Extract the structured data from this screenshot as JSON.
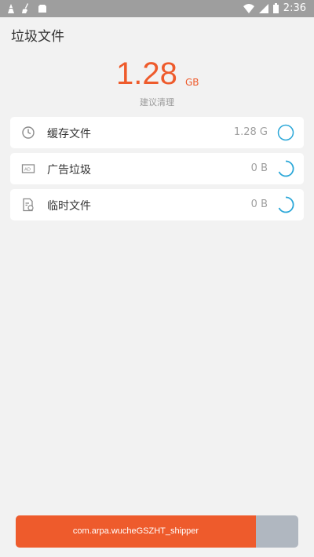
{
  "status_bar": {
    "time": "2:36"
  },
  "header": {
    "title": "垃圾文件"
  },
  "summary": {
    "size_value": "1.28",
    "size_unit": "GB",
    "hint": "建议清理"
  },
  "items": [
    {
      "label": "缓存文件",
      "value": "1.28 G",
      "icon": "clock-icon"
    },
    {
      "label": "广告垃圾",
      "value": "0 B",
      "icon": "ad-icon"
    },
    {
      "label": "临时文件",
      "value": "0 B",
      "icon": "temp-file-icon"
    }
  ],
  "progress": {
    "text": "com.arpa.wucheGSZHT_shipper",
    "fraction": 0.85
  },
  "colors": {
    "accent": "#ee5b2c",
    "spinner": "#2aa7d8",
    "track": "#b0b7c0"
  }
}
